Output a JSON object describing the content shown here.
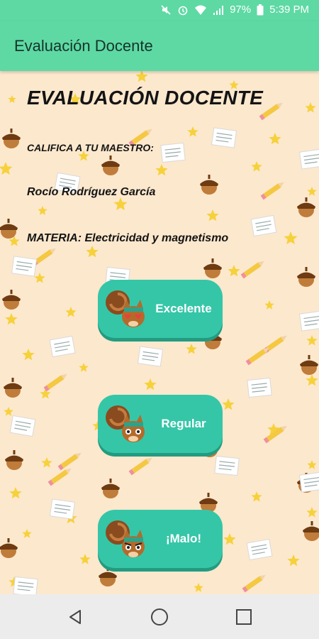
{
  "status_bar": {
    "battery": "97%",
    "time": "5:39 PM"
  },
  "app_bar": {
    "title": "Evaluación Docente"
  },
  "main": {
    "heading": "EVALUACIÓN DOCENTE",
    "prompt": "CALIFICA A TU MAESTRO:",
    "teacher_name": "Rocío Rodríguez García",
    "subject": "MATERIA: Electricidad y magnetismo"
  },
  "buttons": [
    {
      "label": "Excelente",
      "icon": "squirrel-heart-eyes-icon"
    },
    {
      "label": "Regular",
      "icon": "squirrel-neutral-icon"
    },
    {
      "label": "¡Malo!",
      "icon": "squirrel-angry-icon"
    }
  ],
  "nav": {
    "back": "back-triangle-icon",
    "home": "home-circle-icon",
    "recents": "recents-square-icon"
  },
  "colors": {
    "accent": "#5ed9a4",
    "button": "#35c6a8",
    "button_shadow": "#239b80",
    "background": "#fce8cd",
    "star": "#f6d13b"
  }
}
